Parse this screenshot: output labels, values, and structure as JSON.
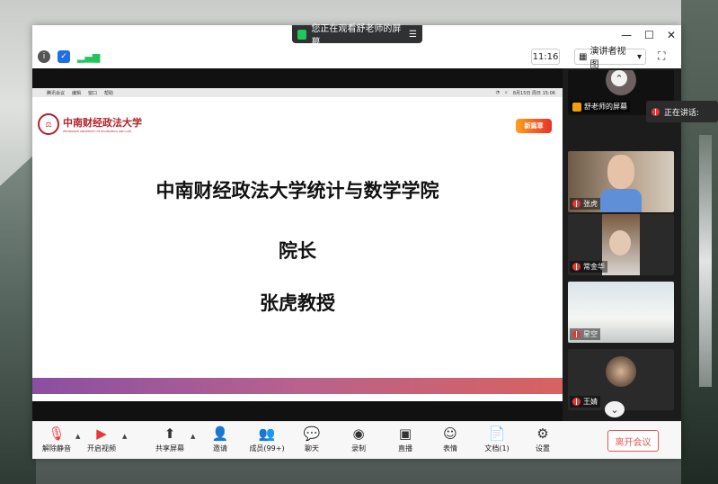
{
  "share_banner": {
    "text": "您正在观看舒老师的屏幕"
  },
  "window_controls": {
    "minimize": "—",
    "maximize": "☐",
    "close": "✕"
  },
  "topbar": {
    "time": "11:16",
    "view_label": "演讲者视图"
  },
  "mac_menu": {
    "app": "腾讯会议",
    "items": [
      "编辑",
      "窗口",
      "帮助"
    ],
    "datetime": "8月15日 周日 15:06"
  },
  "slide": {
    "university_logo_text": "中南财经政法大学",
    "university_logo_sub": "ZHONGNAN UNIVERSITY OF ECONOMICS AND LAW",
    "line1": "中南财经政法大学统计与数学学院",
    "line2": "院长",
    "line3": "张虎教授",
    "badge_text": "新篇章"
  },
  "participants": [
    {
      "name": "舒老师的屏幕"
    },
    {
      "name": "张虎"
    },
    {
      "name": "常金华"
    },
    {
      "name": "星空"
    },
    {
      "name": "王婧"
    }
  ],
  "speaking": {
    "label": "正在讲话:"
  },
  "toolbar": {
    "mute": "解除静音",
    "video": "开启视频",
    "share": "共享屏幕",
    "invite": "邀请",
    "members": "成员(99+)",
    "chat": "聊天",
    "record": "录制",
    "live": "直播",
    "reactions": "表情",
    "docs": "文档(1)",
    "settings": "设置",
    "leave": "离开会议"
  },
  "colors": {
    "accent_red": "#e05858",
    "shield_blue": "#1e6ee6",
    "signal_green": "#22c55e",
    "slide_bar_start": "#8a4fa2",
    "slide_bar_end": "#d8625f"
  }
}
